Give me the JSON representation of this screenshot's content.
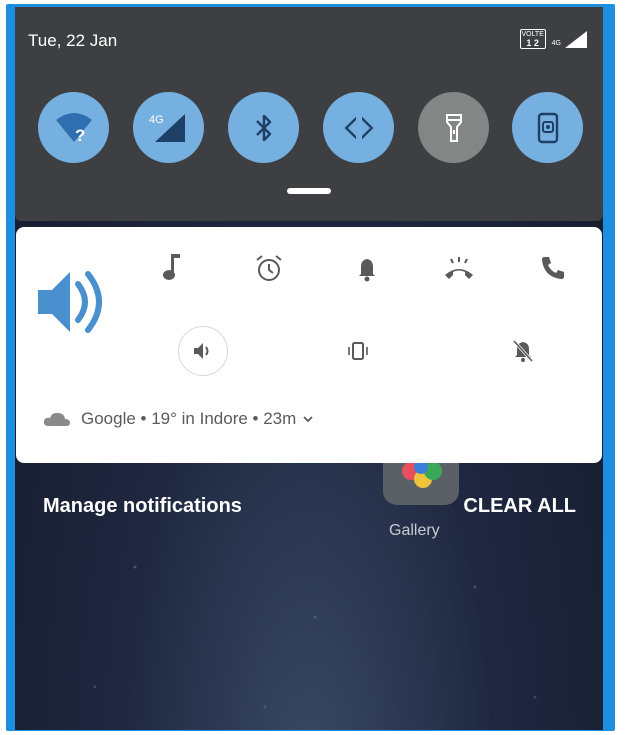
{
  "status_bar": {
    "date": "Tue, 22 Jan",
    "volte_top": "VOLTE",
    "volte_bottom": "1 2",
    "network": "4G"
  },
  "quick_settings": {
    "tiles": [
      {
        "name": "wifi-unknown-icon",
        "active": true
      },
      {
        "name": "mobile-data-icon",
        "label": "4G",
        "active": true
      },
      {
        "name": "bluetooth-icon",
        "active": true
      },
      {
        "name": "auto-rotate-icon",
        "active": true
      },
      {
        "name": "flashlight-icon",
        "active": false
      },
      {
        "name": "screencast-icon",
        "active": true
      }
    ],
    "colors": {
      "active": "#76b0e0",
      "inactive": "#848585",
      "shade": "#3d3f42"
    }
  },
  "volume_panel": {
    "accent": "#4a90cf",
    "streams": [
      "music-note-icon",
      "alarm-clock-icon",
      "bell-icon",
      "ringer-icon",
      "phone-icon"
    ],
    "modes": [
      "sound-on-icon",
      "vibrate-icon",
      "mute-icon"
    ]
  },
  "weather": {
    "text": "Google • 19° in Indore • 23m"
  },
  "notifications": {
    "manage_label": "Manage notifications",
    "clear_label": "CLEAR ALL"
  },
  "home_apps": [
    {
      "label": "Gallery"
    }
  ]
}
